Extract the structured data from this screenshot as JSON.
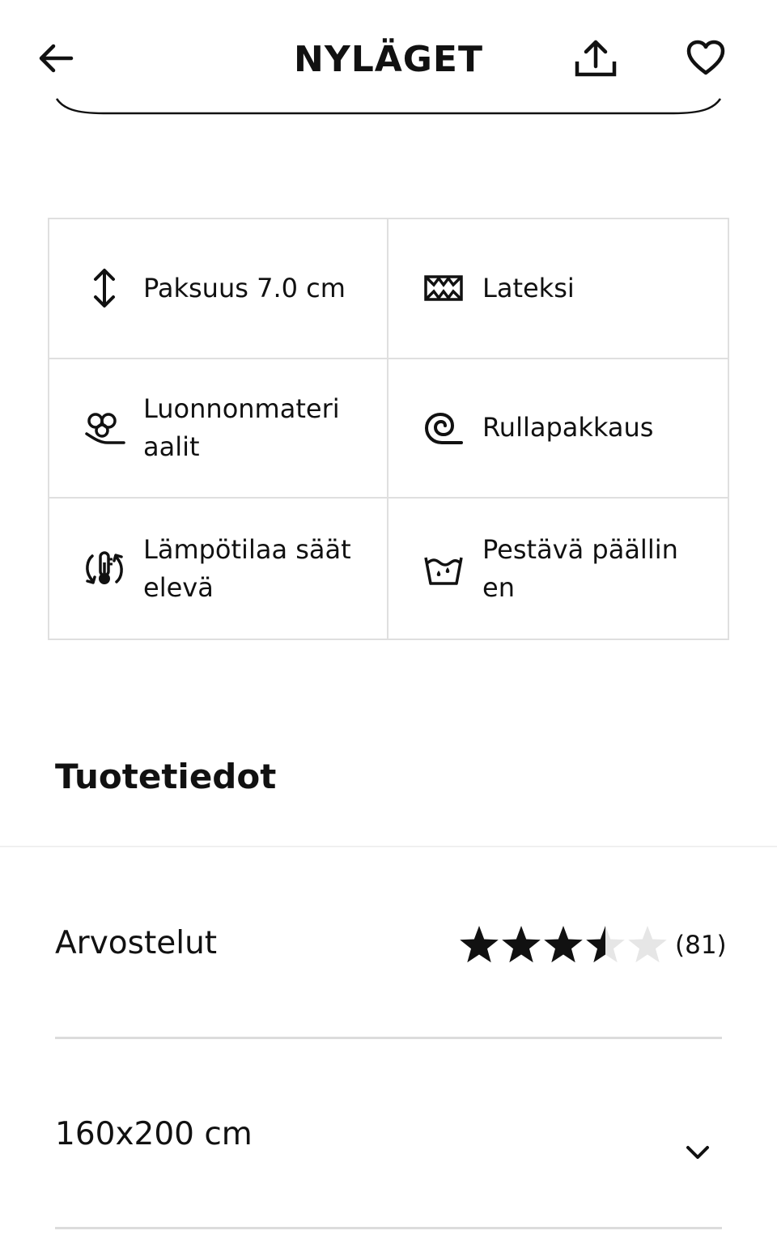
{
  "header": {
    "title": "NYLÄGET",
    "back_icon": "arrow-left-icon",
    "share_icon": "share-upload-icon",
    "favorite_icon": "heart-outline-icon"
  },
  "features": [
    {
      "icon": "thickness-arrows-icon",
      "label": "Paksuus 7.0 cm"
    },
    {
      "icon": "latex-icon",
      "label": "Lateksi"
    },
    {
      "icon": "natural-materials-icon",
      "label": "Luonnonmateri aalit"
    },
    {
      "icon": "roll-pack-icon",
      "label": "Rullapakkaus"
    },
    {
      "icon": "temperature-regulating-icon",
      "label": "Lämpötilaa säätelevä"
    },
    {
      "icon": "washable-cover-icon",
      "label": "Pestävä päällinen"
    }
  ],
  "product_details": {
    "title": "Tuotetiedot"
  },
  "reviews": {
    "label": "Arvostelut",
    "rating": 3.5,
    "max_rating": 5,
    "count": "(81)",
    "star_color": "#111111",
    "empty_star_color": "#e6e6e6"
  },
  "size_selector": {
    "value": "160x200 cm",
    "icon": "chevron-down-icon"
  }
}
